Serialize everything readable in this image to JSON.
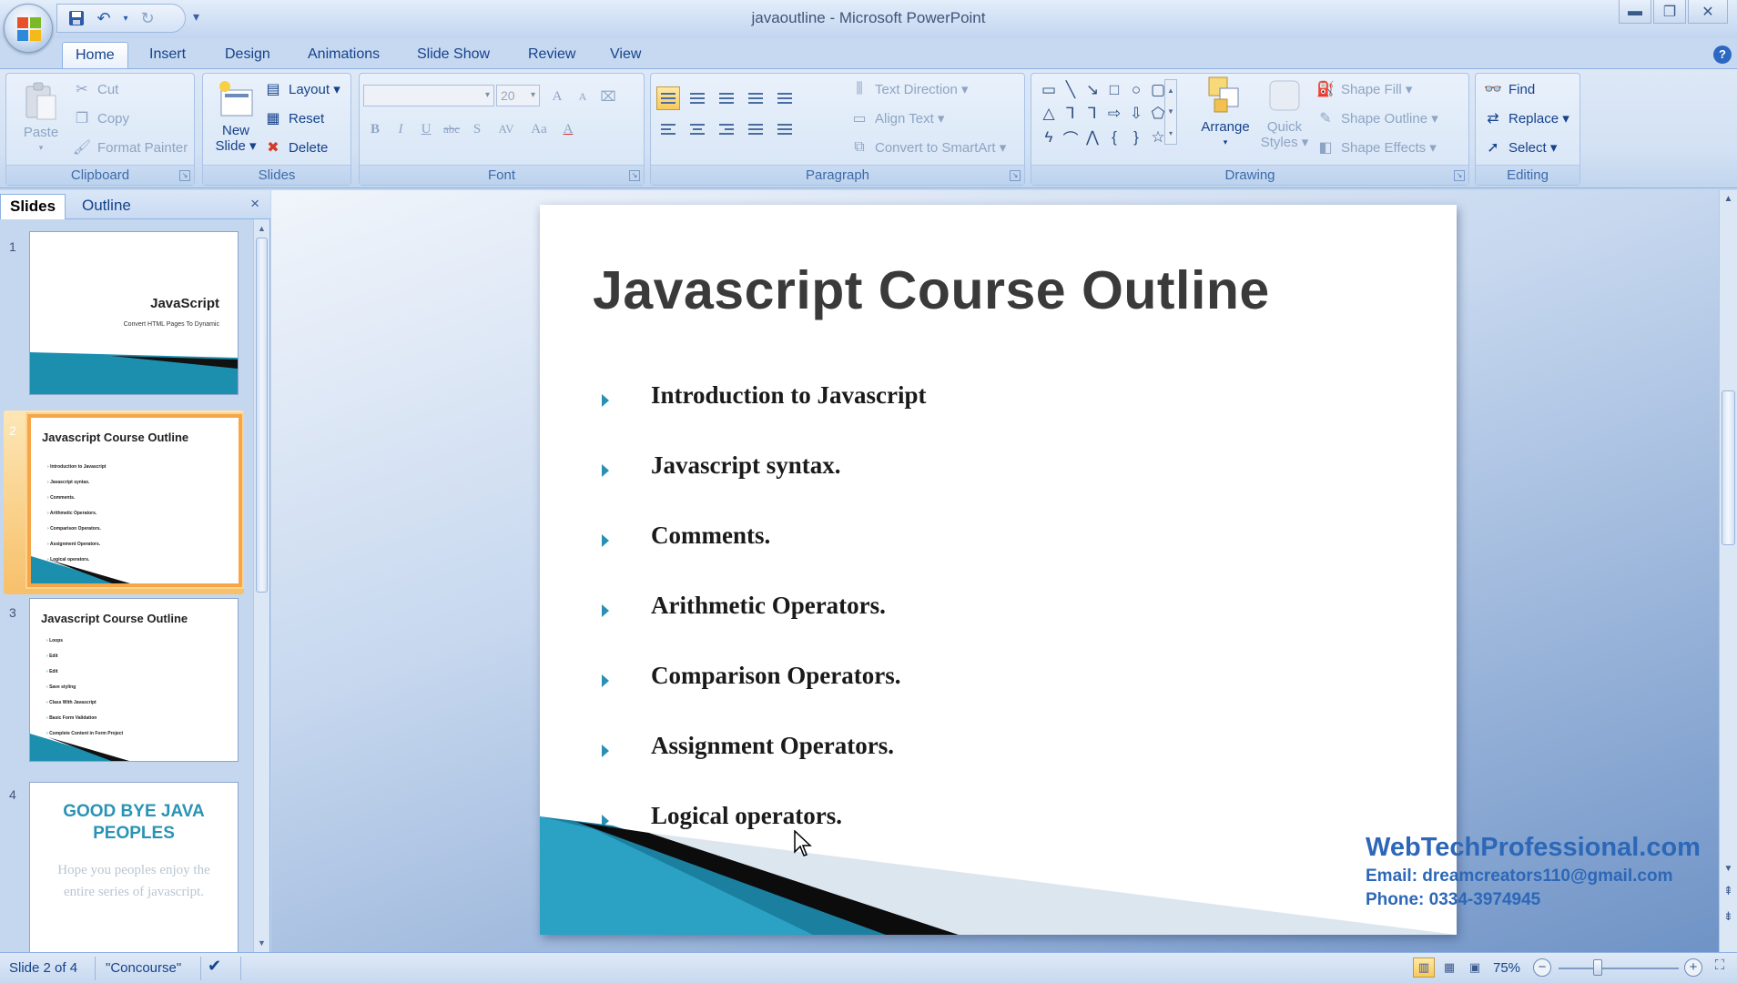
{
  "window": {
    "title": "javaoutline - Microsoft PowerPoint"
  },
  "quick_access": {
    "icons": [
      "save-icon",
      "undo-icon",
      "redo-icon"
    ],
    "customize": "▾"
  },
  "ribbon_tabs": [
    "Home",
    "Insert",
    "Design",
    "Animations",
    "Slide Show",
    "Review",
    "View"
  ],
  "active_tab": "Home",
  "ribbon": {
    "clipboard": {
      "label": "Clipboard",
      "paste": "Paste",
      "cut": "Cut",
      "copy": "Copy",
      "format_painter": "Format Painter"
    },
    "slides": {
      "label": "Slides",
      "new_slide_line1": "New",
      "new_slide_line2": "Slide ▾",
      "layout": "Layout ▾",
      "reset": "Reset",
      "delete": "Delete"
    },
    "font": {
      "label": "Font",
      "font_name": "",
      "font_size": "20",
      "grow": "A",
      "shrink": "A",
      "bold": "B",
      "italic": "I",
      "underline": "U",
      "strike": "abc",
      "shadow": "S",
      "spacing": "AV",
      "case": "Aa",
      "color": "A"
    },
    "paragraph": {
      "label": "Paragraph",
      "text_direction": "Text Direction ▾",
      "align_text": "Align Text ▾",
      "convert_smartart": "Convert to SmartArt ▾"
    },
    "drawing": {
      "label": "Drawing",
      "arrange": "Arrange",
      "quick_styles_line1": "Quick",
      "quick_styles_line2": "Styles ▾",
      "shape_fill": "Shape Fill ▾",
      "shape_outline": "Shape Outline ▾",
      "shape_effects": "Shape Effects ▾",
      "shapes": [
        "▭",
        "╲",
        "↘",
        "□",
        "○",
        "▢",
        "△",
        "⅂",
        "⅂",
        "⇨",
        "⇩",
        "⬠",
        "ϟ",
        "⌒",
        "⋀",
        "{",
        "}",
        "☆"
      ]
    },
    "editing": {
      "label": "Editing",
      "find": "Find",
      "replace": "Replace ▾",
      "select": "Select ▾"
    }
  },
  "pane": {
    "tabs": [
      "Slides",
      "Outline"
    ],
    "active_tab": "Slides",
    "close": "×",
    "thumbnails": [
      {
        "number": "1",
        "title": "JavaScript",
        "subtitle": "Convert HTML Pages To Dynamic"
      },
      {
        "number": "2",
        "title": "Javascript Course Outline",
        "items": [
          "Introduction to Javascript",
          "Javascript syntax.",
          "Comments.",
          "Arithmetic Operators.",
          "Comparison Operators.",
          "Assignment Operators.",
          "Logical operators."
        ]
      },
      {
        "number": "3",
        "title": "Javascript Course Outline",
        "items": [
          "Loops",
          "Edit",
          "Edit",
          "Save styling",
          "Class With Javascript",
          "Basic Form Validation",
          "Complete Content in Form Project"
        ]
      },
      {
        "number": "4",
        "title": "GOOD BYE JAVA PEOPLES",
        "body": "Hope you peoples enjoy the entire series of javascript."
      }
    ]
  },
  "slide": {
    "title": "Javascript Course Outline",
    "bullets": [
      "Introduction to Javascript",
      "Javascript syntax.",
      "Comments.",
      "Arithmetic Operators.",
      "Comparison Operators.",
      "Assignment Operators.",
      "Logical operators."
    ]
  },
  "watermark": {
    "site": "WebTechProfessional.com",
    "email": "Email: dreamcreators110@gmail.com",
    "phone": "Phone: 0334-3974945"
  },
  "statusbar": {
    "slide_info": "Slide 2 of 4",
    "theme": "\"Concourse\"",
    "zoom": "75%"
  },
  "colors": {
    "accent": "#2a8fb2",
    "ribbon_text": "#15428b",
    "selection": "#f6a649",
    "watermark": "#2c67b8"
  }
}
